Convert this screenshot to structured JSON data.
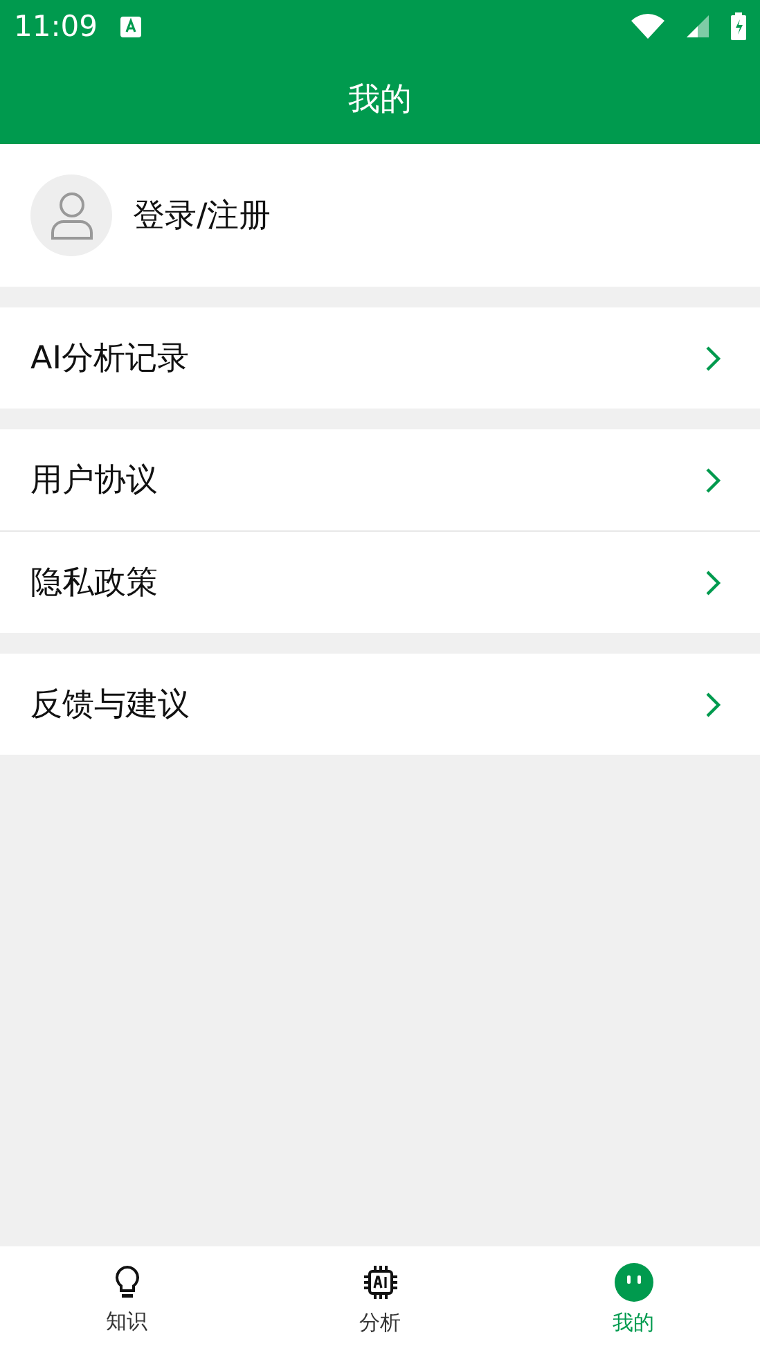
{
  "status_bar": {
    "time": "11:09"
  },
  "header": {
    "title": "我的"
  },
  "profile": {
    "label": "登录/注册"
  },
  "groups": [
    {
      "items": [
        {
          "label": "AI分析记录"
        }
      ]
    },
    {
      "items": [
        {
          "label": "用户协议"
        },
        {
          "label": "隐私政策"
        }
      ]
    },
    {
      "items": [
        {
          "label": "反馈与建议"
        }
      ]
    }
  ],
  "tabs": [
    {
      "label": "知识",
      "kind": "bulb",
      "selected": false
    },
    {
      "label": "分析",
      "kind": "chip",
      "selected": false
    },
    {
      "label": "我的",
      "kind": "face",
      "selected": true
    }
  ]
}
